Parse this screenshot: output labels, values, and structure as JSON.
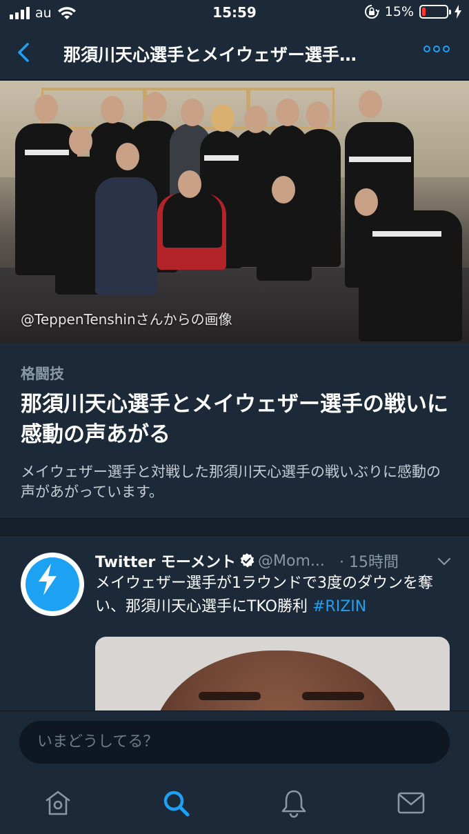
{
  "status_bar": {
    "carrier": "au",
    "time": "15:59",
    "battery_percent": "15%",
    "battery_level": 0.15,
    "battery_color": "#ff3b30"
  },
  "nav": {
    "back_icon": "chevron-left-icon",
    "title": "那須川天心選手とメイウェザー選手…",
    "more_icon": "more-horizontal-icon"
  },
  "hero": {
    "credit": "@TeppenTenshinさんからの画像"
  },
  "moment": {
    "category": "格闘技",
    "title": "那須川天心選手とメイウェザー選手の戦いに感動の声あがる",
    "description": "メイウェザー選手と対戦した那須川天心選手の戦いぶりに感動の声があがっています。"
  },
  "tweet": {
    "avatar_icon": "lightning-bolt-icon",
    "name": "Twitter モーメント",
    "verified_icon": "verified-badge-icon",
    "handle": "@Mom...",
    "time": "· 15時間",
    "text": "メイウェザー選手が1ラウンドで3度のダウンを奪い、那須川天心選手にTKO勝利 ",
    "hashtag": "#RIZIN"
  },
  "compose": {
    "placeholder": "いまどうしてる？"
  },
  "tabs": [
    {
      "icon": "home-icon",
      "active": false
    },
    {
      "icon": "search-icon",
      "active": true
    },
    {
      "icon": "bell-icon",
      "active": false
    },
    {
      "icon": "mail-icon",
      "active": false
    }
  ],
  "colors": {
    "accent": "#1da1f2",
    "background": "#15202b",
    "surface": "#1c2938",
    "secondary_text": "#8899a6"
  }
}
